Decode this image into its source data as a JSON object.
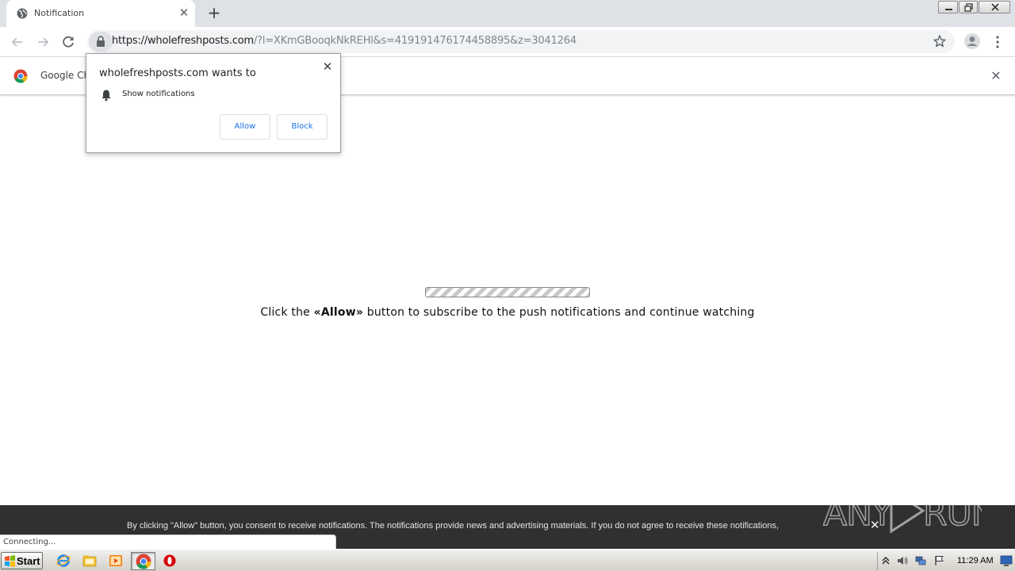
{
  "tab": {
    "title": "Notification",
    "close": "✕"
  },
  "toolbar": {
    "new_tab": "+",
    "url_host": "https://wholefreshposts.com",
    "url_rest": "/?l=XKmGBooqkNkREHl&s=419191476174458895&z=3041264"
  },
  "infobar": {
    "text": "Google Ch",
    "close": "✕"
  },
  "prompt": {
    "title": "wholefreshposts.com wants to",
    "permission": "Show notifications",
    "allow_label": "Allow",
    "block_label": "Block",
    "close": "✕"
  },
  "page": {
    "progress_fraction": 1.0,
    "msg_before": "Click the ",
    "msg_bold": "«Allow»",
    "msg_after": " button to subscribe to the push notifications and continue watching"
  },
  "consent": {
    "text": "By clicking \"Allow\" button, you consent to receive notifications. The notifications provide news and advertising materials. If you do not agree to receive these notifications,",
    "close": "✕"
  },
  "status": {
    "text": "Connecting..."
  },
  "taskbar": {
    "start_label": "Start",
    "clock": "11:29 AM"
  },
  "watermark": {
    "text": "ANY RUN"
  },
  "colors": {
    "accent": "#1a73e8",
    "consent_bg": "#303030",
    "tabstrip": "#dee1e6"
  }
}
